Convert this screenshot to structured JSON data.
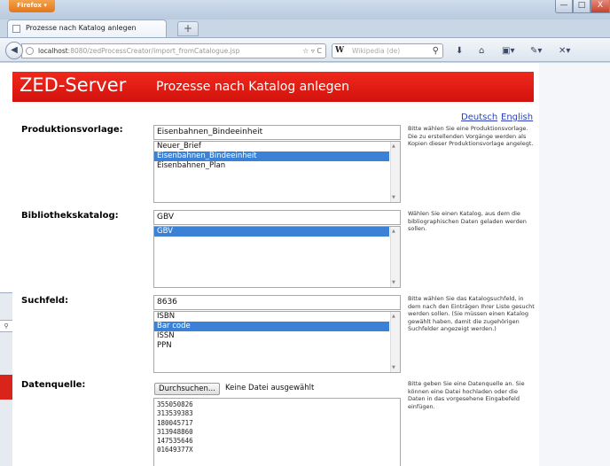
{
  "browser": {
    "app_button": "Firefox",
    "tab_title": "Prozesse nach Katalog anlegen",
    "new_tab": "+",
    "url_host": "localhost",
    "url_rest": ":8080/zedProcessCreator/import_fromCatalogue.jsp",
    "url_controls": "☆ ▿ C",
    "search_engine": "W",
    "search_placeholder": "Wikipedia (de)",
    "window_min": "—",
    "window_max": "□",
    "window_close": "X"
  },
  "page": {
    "banner_title": "ZED-Server",
    "banner_subtitle": "Prozesse nach Katalog anlegen",
    "banner_color": "#e41e14",
    "lang_de": "Deutsch",
    "lang_en": "English"
  },
  "produktionsvorlage": {
    "label": "Produktionsvorlage:",
    "value": "Eisenbahnen_Bindeeinheit",
    "options": [
      "Neuer_Brief",
      "Eisenbahnen_Bindeeinheit",
      "Eisenbahnen_Plan"
    ],
    "selected": "Eisenbahnen_Bindeeinheit",
    "hint": "Bitte wählen Sie eine Produktionsvorlage. Die zu erstellenden Vorgänge werden als Kopien dieser Produktionsvorlage angelegt."
  },
  "bibliothekskatalog": {
    "label": "Bibliothekskatalog:",
    "value": "GBV",
    "options": [
      "GBV"
    ],
    "selected": "GBV",
    "hint": "Wählen Sie einen Katalog, aus dem die bibliographischen Daten geladen werden sollen."
  },
  "suchfeld": {
    "label": "Suchfeld:",
    "value": "8636",
    "options": [
      "ISBN",
      "Bar code",
      "ISSN",
      "PPN"
    ],
    "selected": "Bar code",
    "hint": "Bitte wählen Sie das Katalogsuchfeld, in dem nach den Einträgen Ihrer Liste gesucht werden sollen. (Sie müssen einen Katalog gewählt haben, damit die zugehörigen Suchfelder angezeigt werden.)"
  },
  "datenquelle": {
    "label": "Datenquelle:",
    "button": "Durchsuchen...",
    "file_status": "Keine Datei ausgewählt",
    "lines": [
      "355050826",
      "313539383",
      "180045717",
      "313948860",
      "147535646",
      "01649377X"
    ],
    "hint": "Bitte geben Sie eine Datenquelle an. Sie können eine Datei hochladen oder die Daten in das vorgesehene Eingabefeld einfügen."
  }
}
